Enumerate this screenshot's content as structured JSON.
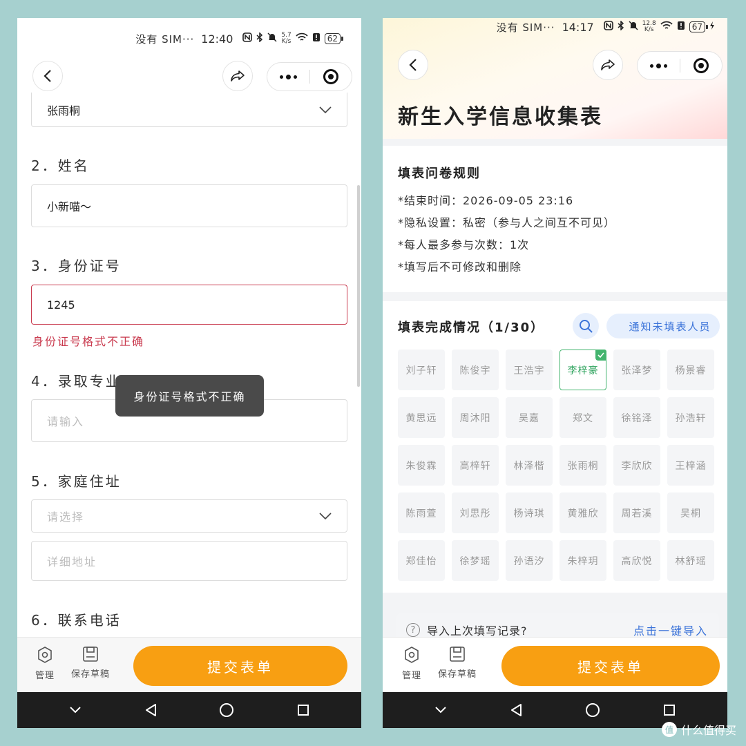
{
  "left": {
    "status": {
      "carrier": "没有 SIM···",
      "time": "12:40",
      "speed": "5.7\nK/s",
      "battery": "62"
    },
    "form": {
      "select1_value": "张雨桐",
      "q2_label": "2．姓名",
      "q2_value": "小新喵～",
      "q3_label": "3．身份证号",
      "q3_value": "1245",
      "q3_error": "身份证号格式不正确",
      "q4_label": "4．录取专业",
      "q4_placeholder": "请输入",
      "q5_label": "5．家庭住址",
      "q5_select_placeholder": "请选择",
      "q5_detail_placeholder": "详细地址",
      "q6_label": "6．联系电话"
    },
    "toast": "身份证号格式不正确",
    "bottom": {
      "manage": "管理",
      "draft": "保存草稿",
      "submit": "提交表单"
    }
  },
  "right": {
    "status": {
      "carrier": "没有 SIM···",
      "time": "14:17",
      "speed": "12.8\nK/s",
      "battery": "67"
    },
    "title": "新生入学信息收集表",
    "rules": {
      "title": "填表问卷规则",
      "items": [
        "*结束时间：2026-09-05 23:16",
        "*隐私设置：私密（参与人之间互不可见）",
        "*每人最多参与次数：1次",
        "*填写后不可修改和删除"
      ]
    },
    "completion": {
      "title": "填表完成情况（1/30）",
      "notify_button": "通知未填表人员",
      "names": [
        "刘子轩",
        "陈俊宇",
        "王浩宇",
        "李梓豪",
        "张泽梦",
        "杨景睿",
        "黄思远",
        "周沐阳",
        "吴嘉",
        "郑文",
        "徐铭泽",
        "孙浩轩",
        "朱俊霖",
        "高梓轩",
        "林泽楷",
        "张雨桐",
        "李欣欣",
        "王梓涵",
        "陈雨萱",
        "刘思彤",
        "杨诗琪",
        "黄雅欣",
        "周若溪",
        "吴桐",
        "郑佳怡",
        "徐梦瑶",
        "孙语汐",
        "朱梓玥",
        "高欣悦",
        "林舒瑶"
      ],
      "done_index": 3
    },
    "import": {
      "text": "导入上次填写记录?",
      "link": "点击一键导入"
    },
    "bottom": {
      "manage": "管理",
      "draft": "保存草稿",
      "submit": "提交表单"
    }
  },
  "watermark": "值 什么值得买",
  "colors": {
    "accent_orange": "#f89f12",
    "error_red": "#c93a4e",
    "link_blue": "#3b73d9",
    "done_green": "#43b46e"
  }
}
